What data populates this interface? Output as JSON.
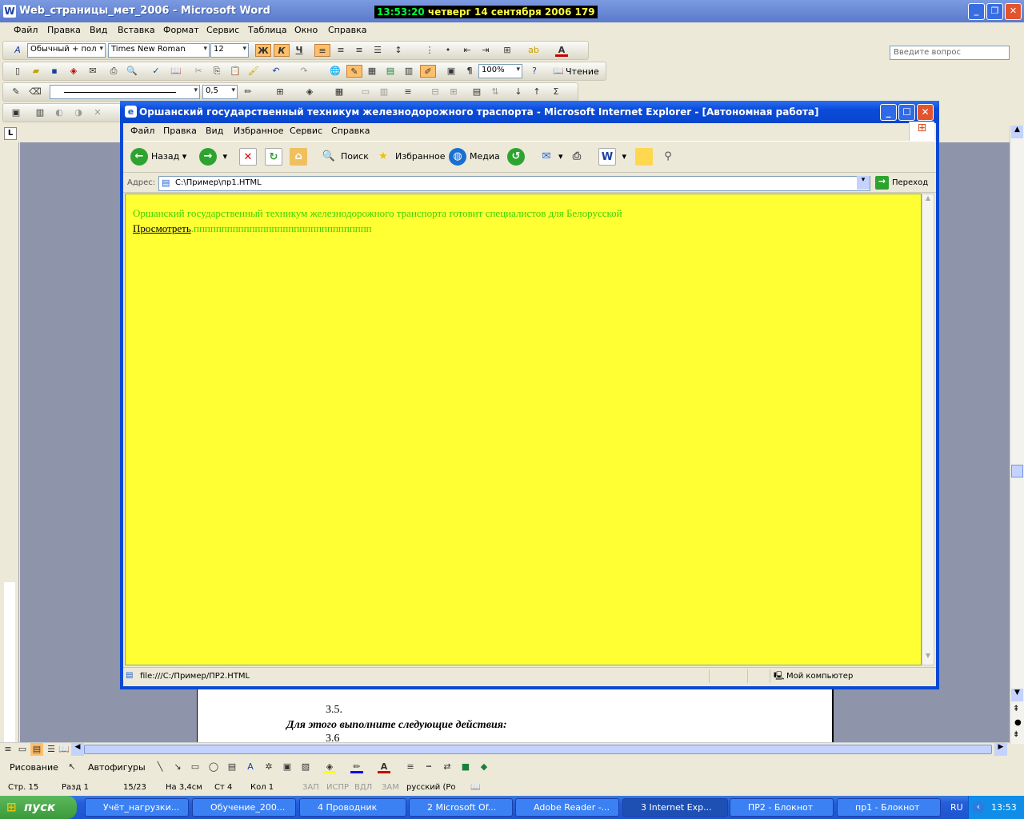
{
  "word": {
    "title": "Web_страницы_мет_2006 - Microsoft Word",
    "clock_time": "13:53:20",
    "clock_date": " четверг 14 сентября 2006 179",
    "menu": [
      "Файл",
      "Правка",
      "Вид",
      "Вставка",
      "Формат",
      "Сервис",
      "Таблица",
      "Окно",
      "Справка"
    ],
    "help_placeholder": "Введите вопрос",
    "style": "Обычный + пол",
    "font": "Times New Roman",
    "size": "12",
    "bold": "Ж",
    "italic": "К",
    "underline": "Ч",
    "zoom": "100%",
    "reading": "Чтение",
    "line_weight": "0,5",
    "doc_lines": [
      "3.5.",
      "Для этого выполните следующие действия:",
      "3.6"
    ],
    "draw_label": "Рисование",
    "autoshapes": "Автофигуры",
    "status": {
      "page": "Стр. 15",
      "section": "Разд 1",
      "pages": "15/23",
      "at": "На 3,4см",
      "line": "Ст 4",
      "col": "Кол 1",
      "rec": "ЗАП",
      "trk": "ИСПР",
      "ext": "ВДЛ",
      "ovr": "ЗАМ",
      "lang": "русский (Ро"
    }
  },
  "ie": {
    "title": "Оршанский государственный техникум железнодорожного траспорта - Microsoft Internet Explorer - [Автономная работа]",
    "menu": [
      "Файл",
      "Правка",
      "Вид",
      "Избранное",
      "Сервис",
      "Справка"
    ],
    "back": "Назад",
    "search": "Поиск",
    "favorites": "Избранное",
    "media": "Медиа",
    "address_label": "Адрес:",
    "address": "C:\\Пример\\пр1.HTML",
    "go": "Переход",
    "content_line1": "Оршанский государственный техникум железнодорожного транспорта готовит специалистов для Белорусской",
    "content_link": "Просмотреть",
    "content_rest": ".пппппппппппппппппппппппппппппппп",
    "status_url": "file:///C:/Пример/ПР2.HTML",
    "status_zone": "Мой компьютер",
    "page_bg": "#ffff33",
    "text_color": "#3fd300"
  },
  "taskbar": {
    "start": "пуск",
    "tasks": [
      "Учёт_нагрузки...",
      "Обучение_200...",
      "4 Проводник",
      "2 Microsoft Of...",
      "Adobe Reader -...",
      "3 Internet Exp...",
      "ПР2 - Блокнот",
      "пр1 - Блокнот"
    ],
    "lang": "RU",
    "time": "13:53"
  }
}
